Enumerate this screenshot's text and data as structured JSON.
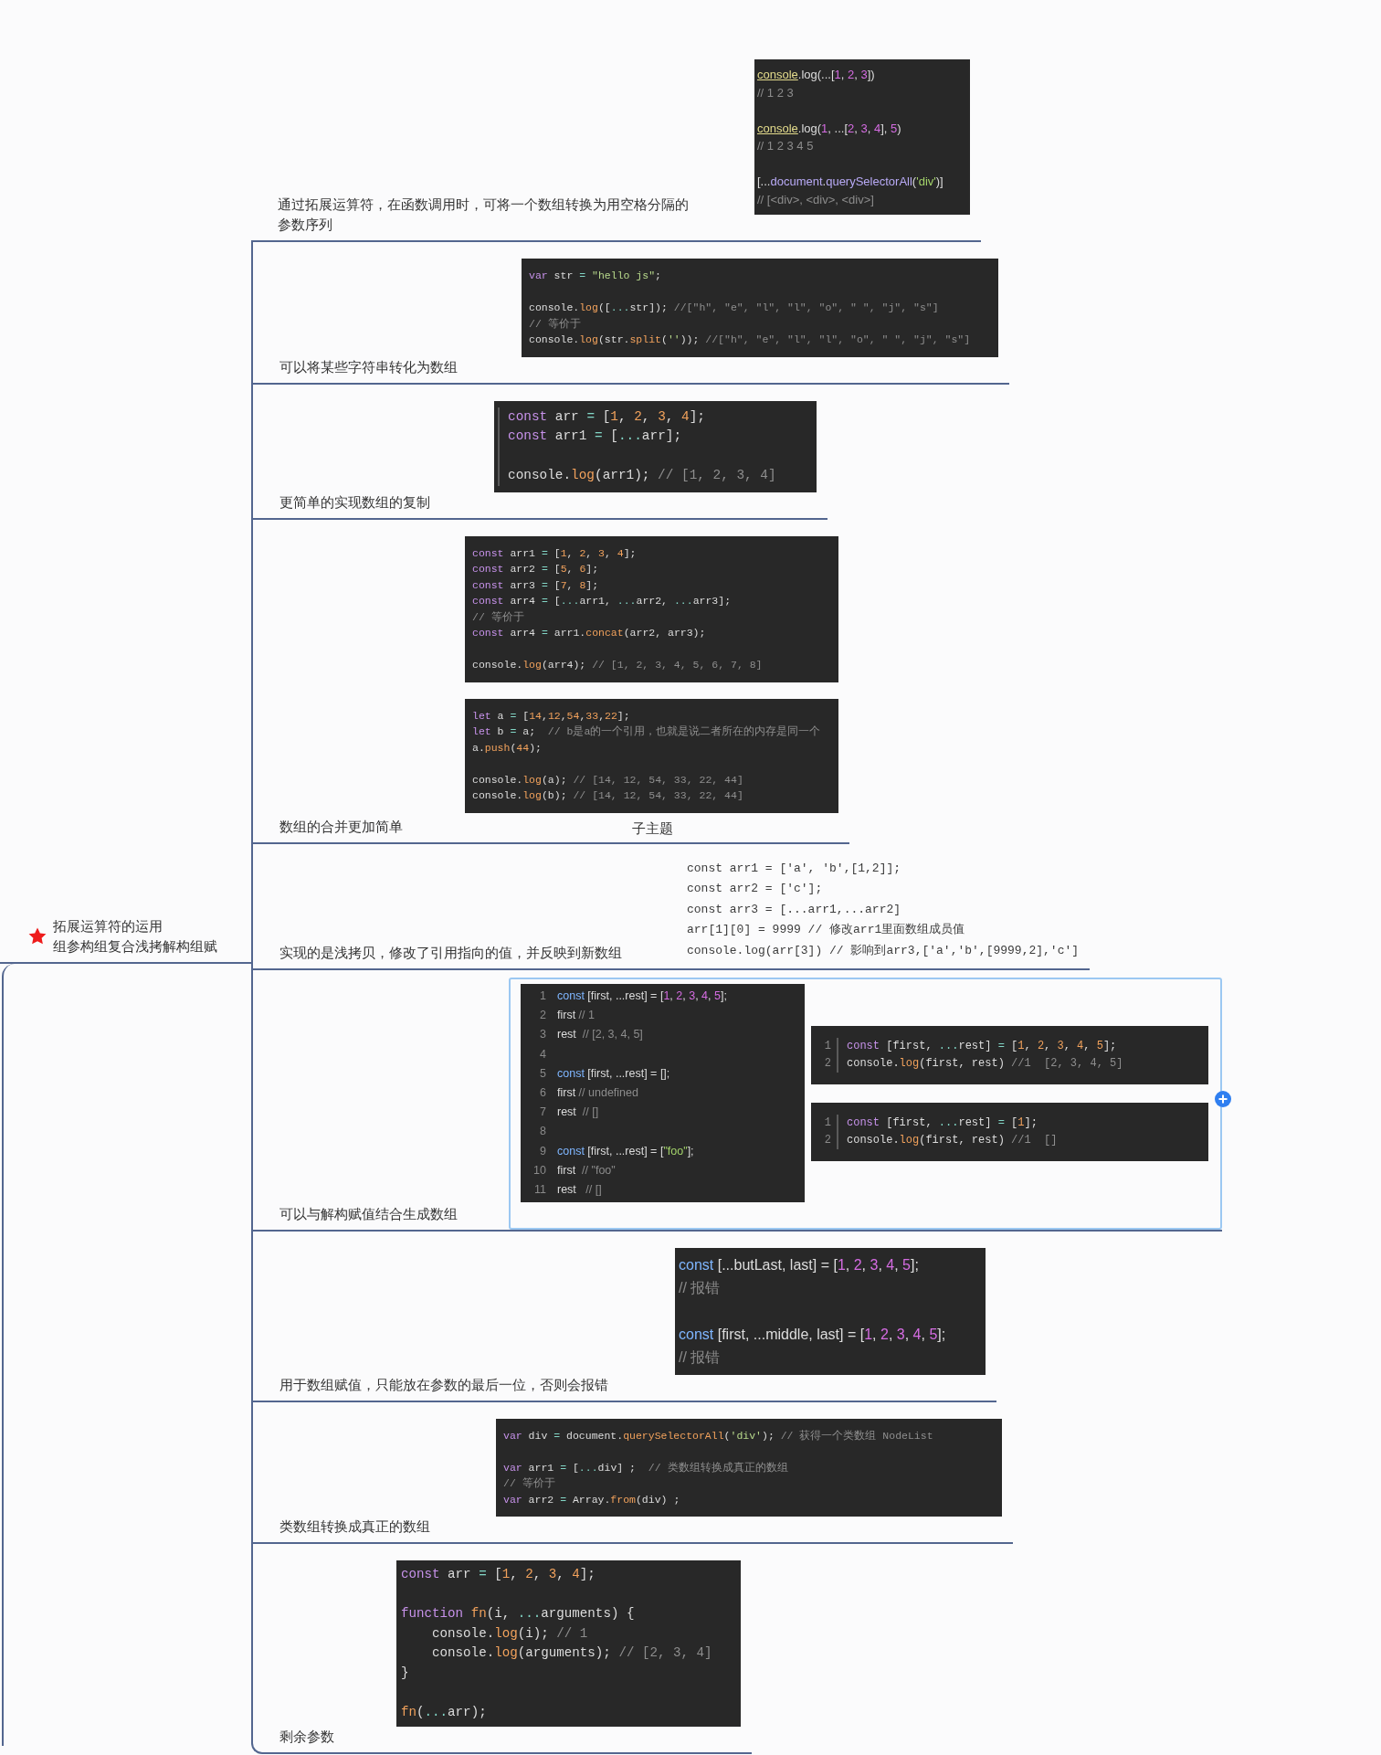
{
  "root": {
    "title_lines": [
      "拓展运算符的运用",
      "组参构组复合浅拷解构组赋"
    ]
  },
  "branches": [
    {
      "kind": "code",
      "selected": false,
      "label": "通过拓展运算符，在函数调用时，可将一个数组转换为用空格分隔的参数序列",
      "blocks": [
        {
          "kind": "snippet",
          "paragraphs": [
            [
              [
                {
                  "kind": "link",
                  "text": "console"
                },
                ".log(...[",
                {
                  "kind": "num",
                  "text": "1"
                },
                ", ",
                {
                  "kind": "num",
                  "text": "2"
                },
                ", ",
                {
                  "kind": "num",
                  "text": "3"
                },
                "])"
              ],
              [
                {
                  "kind": "cm",
                  "text": "// 1 2 3"
                }
              ]
            ],
            [
              [
                {
                  "kind": "link",
                  "text": "console"
                },
                ".log(",
                {
                  "kind": "num",
                  "text": "1"
                },
                ", ...[",
                {
                  "kind": "num",
                  "text": "2"
                },
                ", ",
                {
                  "kind": "num",
                  "text": "3"
                },
                ", ",
                {
                  "kind": "num",
                  "text": "4"
                },
                "], ",
                {
                  "kind": "num",
                  "text": "5"
                },
                ")"
              ],
              [
                {
                  "kind": "cm",
                  "text": "// 1 2 3 4 5"
                }
              ]
            ],
            [
              [
                "[...",
                {
                  "kind": "fn",
                  "text": "document"
                },
                ".",
                {
                  "kind": "fn",
                  "text": "querySelectorAll"
                },
                "(",
                {
                  "kind": "str",
                  "text": "'div'"
                },
                ")]"
              ],
              [
                {
                  "kind": "cm",
                  "text": "// [<div>, <div>, <div>]"
                }
              ]
            ]
          ]
        }
      ]
    },
    {
      "kind": "code",
      "selected": false,
      "label": "可以将某些字符串转化为数组",
      "blocks": [
        {
          "kind": "editor",
          "paragraphs": [
            [
              [
                {
                  "kind": "kw",
                  "text": "var"
                },
                " str ",
                {
                  "kind": "op",
                  "text": "="
                },
                {
                  "kind": "str",
                  "text": " \"hello js\""
                },
                ";"
              ]
            ],
            [
              [
                "console.",
                {
                  "kind": "fn",
                  "text": "log"
                },
                "([",
                {
                  "kind": "op",
                  "text": "..."
                },
                "str]); ",
                {
                  "kind": "cm",
                  "text": "//[\"h\", \"e\", \"l\", \"l\", \"o\", \" \", \"j\", \"s\"]"
                }
              ],
              [
                {
                  "kind": "cm",
                  "text": "// 等价于"
                }
              ],
              [
                "console.",
                {
                  "kind": "fn",
                  "text": "log"
                },
                "(str.",
                {
                  "kind": "fn",
                  "text": "split"
                },
                "(",
                {
                  "kind": "str",
                  "text": "''"
                },
                ")); ",
                {
                  "kind": "cm",
                  "text": "//[\"h\", \"e\", \"l\", \"l\", \"o\", \" \", \"j\", \"s\"]"
                }
              ]
            ]
          ]
        }
      ]
    },
    {
      "kind": "code",
      "selected": false,
      "label": "更简单的实现数组的复制",
      "blocks": [
        {
          "kind": "quoted",
          "paragraphs": [
            [
              [
                {
                  "kind": "kw",
                  "text": "const"
                },
                " arr ",
                {
                  "kind": "op",
                  "text": "="
                },
                " [",
                {
                  "kind": "num",
                  "text": "1"
                },
                ", ",
                {
                  "kind": "num",
                  "text": "2"
                },
                ", ",
                {
                  "kind": "num",
                  "text": "3"
                },
                ", ",
                {
                  "kind": "num",
                  "text": "4"
                },
                "];"
              ],
              [
                {
                  "kind": "kw",
                  "text": "const"
                },
                " arr1 ",
                {
                  "kind": "op",
                  "text": "="
                },
                " [",
                {
                  "kind": "op",
                  "text": "..."
                },
                "arr];"
              ]
            ],
            [
              [
                "console.",
                {
                  "kind": "fn",
                  "text": "log"
                },
                "(arr1); ",
                {
                  "kind": "cm",
                  "text": "// [1, 2, 3, 4]"
                }
              ]
            ]
          ]
        }
      ]
    },
    {
      "kind": "code",
      "selected": false,
      "label": "数组的合并更加简单",
      "subtopic": "子主题",
      "blocks": [
        {
          "kind": "editor",
          "paragraphs": [
            [
              [
                {
                  "kind": "kw",
                  "text": "const"
                },
                " arr1 ",
                {
                  "kind": "op",
                  "text": "="
                },
                " [",
                {
                  "kind": "num",
                  "text": "1"
                },
                ", ",
                {
                  "kind": "num",
                  "text": "2"
                },
                ", ",
                {
                  "kind": "num",
                  "text": "3"
                },
                ", ",
                {
                  "kind": "num",
                  "text": "4"
                },
                "];"
              ],
              [
                {
                  "kind": "kw",
                  "text": "const"
                },
                " arr2 ",
                {
                  "kind": "op",
                  "text": "="
                },
                " [",
                {
                  "kind": "num",
                  "text": "5"
                },
                ", ",
                {
                  "kind": "num",
                  "text": "6"
                },
                "];"
              ],
              [
                {
                  "kind": "kw",
                  "text": "const"
                },
                " arr3 ",
                {
                  "kind": "op",
                  "text": "="
                },
                " [",
                {
                  "kind": "num",
                  "text": "7"
                },
                ", ",
                {
                  "kind": "num",
                  "text": "8"
                },
                "];"
              ],
              [
                {
                  "kind": "kw",
                  "text": "const"
                },
                " arr4 ",
                {
                  "kind": "op",
                  "text": "="
                },
                " [",
                {
                  "kind": "op",
                  "text": "..."
                },
                "arr1, ",
                {
                  "kind": "op",
                  "text": "..."
                },
                "arr2, ",
                {
                  "kind": "op",
                  "text": "..."
                },
                "arr3];"
              ],
              [
                {
                  "kind": "cm",
                  "text": "// 等价于"
                }
              ],
              [
                {
                  "kind": "kw",
                  "text": "const"
                },
                " arr4 ",
                {
                  "kind": "op",
                  "text": "="
                },
                " arr1.",
                {
                  "kind": "fn",
                  "text": "concat"
                },
                "(arr2, arr3);"
              ]
            ],
            [
              [
                "console.",
                {
                  "kind": "fn",
                  "text": "log"
                },
                "(arr4); ",
                {
                  "kind": "cm",
                  "text": "// [1, 2, 3, 4, 5, 6, 7, 8]"
                }
              ]
            ]
          ]
        },
        {
          "kind": "editor",
          "paragraphs": [
            [
              [
                {
                  "kind": "kw",
                  "text": "let"
                },
                " a ",
                {
                  "kind": "op",
                  "text": "="
                },
                " [",
                {
                  "kind": "num",
                  "text": "14"
                },
                ",",
                {
                  "kind": "num",
                  "text": "12"
                },
                ",",
                {
                  "kind": "num",
                  "text": "54"
                },
                ",",
                {
                  "kind": "num",
                  "text": "33"
                },
                ",",
                {
                  "kind": "num",
                  "text": "22"
                },
                "];"
              ],
              [
                {
                  "kind": "kw",
                  "text": "let"
                },
                " b ",
                {
                  "kind": "op",
                  "text": "="
                },
                " a;  ",
                {
                  "kind": "cm",
                  "text": "// b是a的一个引用，也就是说二者所在的内存是同一个"
                }
              ],
              [
                "a.",
                {
                  "kind": "fn",
                  "text": "push"
                },
                "(",
                {
                  "kind": "num",
                  "text": "44"
                },
                ");"
              ]
            ],
            [
              [
                "console.",
                {
                  "kind": "fn",
                  "text": "log"
                },
                "(a); ",
                {
                  "kind": "cm",
                  "text": "// [14, 12, 54, 33, 22, 44]"
                }
              ],
              [
                "console.",
                {
                  "kind": "fn",
                  "text": "log"
                },
                "(b); ",
                {
                  "kind": "cm",
                  "text": "// [14, 12, 54, 33, 22, 44]"
                }
              ]
            ]
          ]
        }
      ]
    },
    {
      "kind": "notes",
      "selected": false,
      "label": "实现的是浅拷贝，修改了引用指向的值，并反映到新数组",
      "lines": [
        "const arr1 = ['a', 'b',[1,2]];",
        "const arr2 = ['c'];",
        "const arr3 = [...arr1,...arr2]",
        "arr[1][0] = 9999 // 修改arr1里面数组成员值",
        "console.log(arr[3]) // 影响到arr3,['a','b',[9999,2],'c']"
      ]
    },
    {
      "kind": "split",
      "selected": true,
      "label": "可以与解构赋值结合生成数组",
      "blocks": [
        {
          "kind": "numbered",
          "line_numbers": [
            "1",
            "2",
            "3",
            "4",
            "5",
            "6",
            "7",
            "8",
            "9",
            "10",
            "11"
          ],
          "paragraphs": [
            [
              [
                {
                  "kind": "kw",
                  "text": "const"
                },
                " [first, ...rest] = [",
                {
                  "kind": "num",
                  "text": "1"
                },
                ", ",
                {
                  "kind": "num",
                  "text": "2"
                },
                ", ",
                {
                  "kind": "num",
                  "text": "3"
                },
                ", ",
                {
                  "kind": "num",
                  "text": "4"
                },
                ", ",
                {
                  "kind": "num",
                  "text": "5"
                },
                "];"
              ],
              [
                "first ",
                {
                  "kind": "cm",
                  "text": "// 1"
                }
              ],
              [
                "rest  ",
                {
                  "kind": "cm",
                  "text": "// [2, 3, 4, 5]"
                }
              ]
            ],
            [
              [
                {
                  "kind": "kw",
                  "text": "const"
                },
                " [first, ...rest] = [];"
              ],
              [
                "first ",
                {
                  "kind": "cm",
                  "text": "// undefined"
                }
              ],
              [
                "rest  ",
                {
                  "kind": "cm",
                  "text": "// []"
                }
              ]
            ],
            [
              [
                {
                  "kind": "kw",
                  "text": "const"
                },
                " [first, ...rest] = [",
                {
                  "kind": "str",
                  "text": "\"foo\""
                },
                "];"
              ],
              [
                "first  ",
                {
                  "kind": "cm",
                  "text": "// \"foo\""
                }
              ],
              [
                "rest   ",
                {
                  "kind": "cm",
                  "text": "// []"
                }
              ]
            ]
          ]
        },
        {
          "kind": "numbered-editor",
          "line_numbers": [
            "1",
            "2"
          ],
          "paragraphs": [
            [
              [
                {
                  "kind": "kw",
                  "text": "const"
                },
                " [first, ",
                {
                  "kind": "op",
                  "text": "..."
                },
                "rest] ",
                {
                  "kind": "op",
                  "text": "="
                },
                " [",
                {
                  "kind": "num",
                  "text": "1"
                },
                ", ",
                {
                  "kind": "num",
                  "text": "2"
                },
                ", ",
                {
                  "kind": "num",
                  "text": "3"
                },
                ", ",
                {
                  "kind": "num",
                  "text": "4"
                },
                ", ",
                {
                  "kind": "num",
                  "text": "5"
                },
                "];"
              ],
              [
                "console.",
                {
                  "kind": "fn",
                  "text": "log"
                },
                "(first, rest) ",
                {
                  "kind": "cm",
                  "text": "//1  [2, 3, 4, 5]"
                }
              ]
            ]
          ]
        },
        {
          "kind": "numbered-editor",
          "line_numbers": [
            "1",
            "2"
          ],
          "paragraphs": [
            [
              [
                {
                  "kind": "kw",
                  "text": "const"
                },
                " [first, ",
                {
                  "kind": "op",
                  "text": "..."
                },
                "rest] ",
                {
                  "kind": "op",
                  "text": "="
                },
                " [",
                {
                  "kind": "num",
                  "text": "1"
                },
                "];"
              ],
              [
                "console.",
                {
                  "kind": "fn",
                  "text": "log"
                },
                "(first, rest) ",
                {
                  "kind": "cm",
                  "text": "//1  []"
                }
              ]
            ]
          ]
        }
      ]
    },
    {
      "kind": "code",
      "selected": false,
      "label": "用于数组赋值，只能放在参数的最后一位，否则会报错",
      "blocks": [
        {
          "kind": "snippet-large",
          "paragraphs": [
            [
              [
                {
                  "kind": "kw",
                  "text": "const"
                },
                " [...butLast, last] = [",
                {
                  "kind": "num",
                  "text": "1"
                },
                ", ",
                {
                  "kind": "num",
                  "text": "2"
                },
                ", ",
                {
                  "kind": "num",
                  "text": "3"
                },
                ", ",
                {
                  "kind": "num",
                  "text": "4"
                },
                ", ",
                {
                  "kind": "num",
                  "text": "5"
                },
                "];"
              ],
              [
                {
                  "kind": "cm",
                  "text": "// 报错"
                }
              ]
            ],
            [
              [
                {
                  "kind": "kw",
                  "text": "const"
                },
                " [first, ...middle, last] = [",
                {
                  "kind": "num",
                  "text": "1"
                },
                ", ",
                {
                  "kind": "num",
                  "text": "2"
                },
                ", ",
                {
                  "kind": "num",
                  "text": "3"
                },
                ", ",
                {
                  "kind": "num",
                  "text": "4"
                },
                ", ",
                {
                  "kind": "num",
                  "text": "5"
                },
                "];"
              ],
              [
                {
                  "kind": "cm",
                  "text": "// 报错"
                }
              ]
            ]
          ]
        }
      ]
    },
    {
      "kind": "code",
      "selected": false,
      "label": "类数组转换成真正的数组",
      "blocks": [
        {
          "kind": "editor",
          "paragraphs": [
            [
              [
                {
                  "kind": "kw",
                  "text": "var"
                },
                " div ",
                {
                  "kind": "op",
                  "text": "="
                },
                " document.",
                {
                  "kind": "fn",
                  "text": "querySelectorAll"
                },
                "(",
                {
                  "kind": "str",
                  "text": "'div'"
                },
                "); ",
                {
                  "kind": "cm",
                  "text": "// 获得一个类数组 NodeList"
                }
              ]
            ],
            [
              [
                {
                  "kind": "kw",
                  "text": "var"
                },
                " arr1 ",
                {
                  "kind": "op",
                  "text": "="
                },
                " [",
                {
                  "kind": "op",
                  "text": "..."
                },
                "div] ;  ",
                {
                  "kind": "cm",
                  "text": "// 类数组转换成真正的数组"
                }
              ],
              [
                {
                  "kind": "cm",
                  "text": "// 等价于"
                }
              ],
              [
                {
                  "kind": "kw",
                  "text": "var"
                },
                " arr2 ",
                {
                  "kind": "op",
                  "text": "="
                },
                " Array.",
                {
                  "kind": "fn",
                  "text": "from"
                },
                "(div) ;"
              ]
            ]
          ]
        }
      ]
    },
    {
      "kind": "code",
      "selected": false,
      "label": "剩余参数",
      "blocks": [
        {
          "kind": "editor-large",
          "paragraphs": [
            [
              [
                {
                  "kind": "kw",
                  "text": "const"
                },
                " arr ",
                {
                  "kind": "op",
                  "text": "="
                },
                " [",
                {
                  "kind": "num",
                  "text": "1"
                },
                ", ",
                {
                  "kind": "num",
                  "text": "2"
                },
                ", ",
                {
                  "kind": "num",
                  "text": "3"
                },
                ", ",
                {
                  "kind": "num",
                  "text": "4"
                },
                "];"
              ]
            ],
            [
              [
                {
                  "kind": "kw",
                  "text": "function "
                },
                {
                  "kind": "fn",
                  "text": "fn"
                },
                "(i, ",
                {
                  "kind": "op",
                  "text": "..."
                },
                "arguments) {"
              ],
              [
                "    console.",
                {
                  "kind": "fn",
                  "text": "log"
                },
                "(i); ",
                {
                  "kind": "cm",
                  "text": "// 1"
                }
              ],
              [
                "    console.",
                {
                  "kind": "fn",
                  "text": "log"
                },
                "(arguments); ",
                {
                  "kind": "cm",
                  "text": "// [2, 3, 4]"
                }
              ],
              [
                "}"
              ]
            ],
            [
              [
                {
                  "kind": "fn",
                  "text": "fn"
                },
                "(",
                {
                  "kind": "op",
                  "text": "..."
                },
                "arr);"
              ]
            ]
          ]
        }
      ]
    }
  ]
}
